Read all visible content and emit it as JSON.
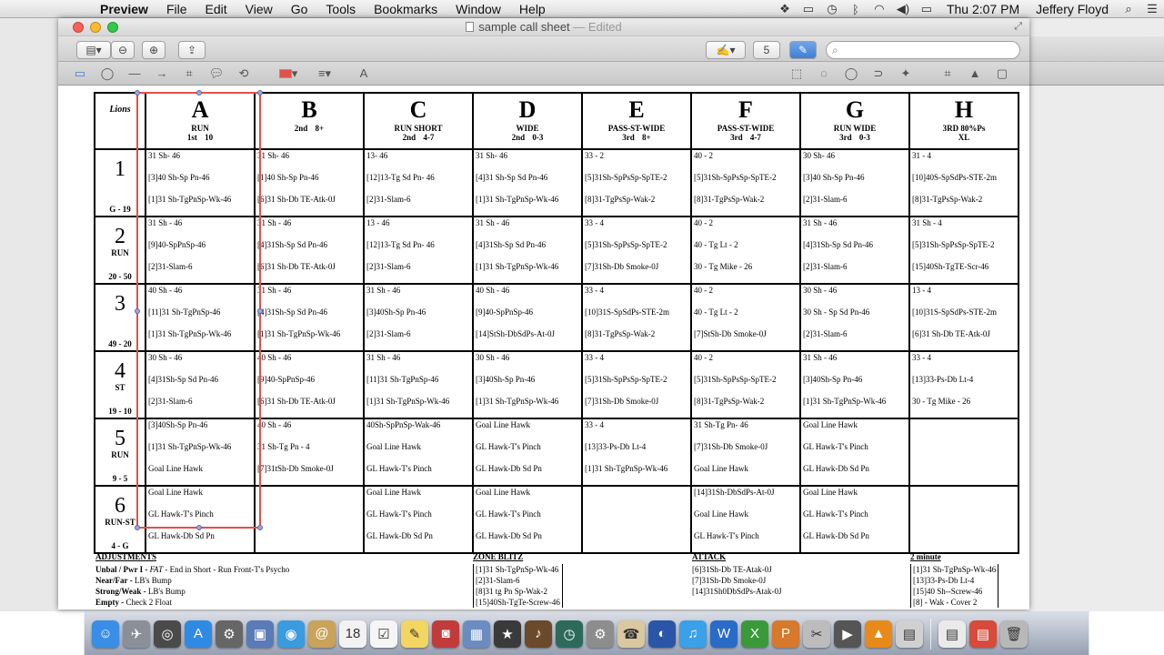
{
  "menubar": {
    "app": "Preview",
    "items": [
      "File",
      "Edit",
      "View",
      "Go",
      "Tools",
      "Bookmarks",
      "Window",
      "Help"
    ],
    "clock": "Thu 2:07 PM",
    "user": "Jeffery Floyd"
  },
  "window": {
    "title": "sample call sheet",
    "title_status": "— Edited",
    "toolbar_number": "5",
    "search_placeholder": ""
  },
  "grid": {
    "corner_label": "Lions",
    "columns": [
      {
        "letter": "A",
        "cat": "RUN",
        "sub": "1st 10"
      },
      {
        "letter": "B",
        "cat": "",
        "sub": "2nd 8+"
      },
      {
        "letter": "C",
        "cat": "RUN SHORT",
        "sub": "2nd 4-7"
      },
      {
        "letter": "D",
        "cat": "WIDE",
        "sub": "2nd 0-3"
      },
      {
        "letter": "E",
        "cat": "PASS-ST-WIDE",
        "sub": "3rd 8+"
      },
      {
        "letter": "F",
        "cat": "PASS-ST-WIDE",
        "sub": "3rd 4-7"
      },
      {
        "letter": "G",
        "cat": "RUN WIDE",
        "sub": "3rd 0-3"
      },
      {
        "letter": "H",
        "cat": "3RD 80%Ps",
        "sub": "XL"
      }
    ],
    "rows": [
      {
        "num": "1",
        "type": "",
        "range": "G - 19",
        "cells": [
          [
            "31 Sh- 46",
            "[3]40 Sh-Sp Pn-46",
            "[1]31 Sh-TgPnSp-Wk-46"
          ],
          [
            "31 Sh- 46",
            "[1]40 Sh-Sp Pn-46",
            "[6]31 Sh-Db TE-Atk-0J"
          ],
          [
            "13- 46",
            "[12]13-Tg Sd Pn- 46",
            "[2]31-Slam-6"
          ],
          [
            "31 Sh- 46",
            "[4]31 Sh-Sp Sd Pn-46",
            "[1]31 Sh-TgPnSp-Wk-46"
          ],
          [
            "33 - 2",
            "[5]31Sh-SpPsSp-SpTE-2",
            "[8]31-TgPsSp-Wak-2"
          ],
          [
            "40 - 2",
            "[5]31Sh-SpPsSp-SpTE-2",
            "[8]31-TgPsSp-Wak-2"
          ],
          [
            "30 Sh- 46",
            "[3]40 Sh-Sp Pn-46",
            "[2]31-Slam-6"
          ],
          [
            "31 - 4",
            "[10]40S-SpSdPs-STE-2m",
            "[8]31-TgPsSp-Wak-2"
          ]
        ]
      },
      {
        "num": "2",
        "type": "RUN",
        "range": "20 - 50",
        "cells": [
          [
            "31 Sh - 46",
            "[9]40-SpPnSp-46",
            "[2]31-Slam-6"
          ],
          [
            "31 Sh - 46",
            "[4]31Sh-Sp Sd Pn-46",
            "[6]31 Sh-Db TE-Atk-0J"
          ],
          [
            "13 - 46",
            "[12]13-Tg Sd Pn- 46",
            "[2]31-Slam-6"
          ],
          [
            "31 Sh - 46",
            "[4]31Sh-Sp Sd Pn-46",
            "[1]31 Sh-TgPnSp-Wk-46"
          ],
          [
            "33 - 4",
            "[5]31Sh-SpPsSp-SpTE-2",
            "[7]31Sh-Db Smoke-0J"
          ],
          [
            "40 - 2",
            "40 - Tg Lt - 2",
            "30 - Tg Mike - 26"
          ],
          [
            "31 Sh - 46",
            "[4]31Sh-Sp Sd Pn-46",
            "[2]31-Slam-6"
          ],
          [
            "31 Sh - 4",
            "[5]31Sh-SpPsSp-SpTE-2",
            "[15]40Sh-TgTE-Scr-46"
          ]
        ]
      },
      {
        "num": "3",
        "type": "",
        "range": "49 - 20",
        "cells": [
          [
            "40 Sh - 46",
            "[11]31 Sh-TgPnSp-46",
            "[1]31 Sh-TgPnSp-Wk-46"
          ],
          [
            "31 Sh - 46",
            "[4]31Sh-Sp Sd Pn-46",
            "[1]31 Sh-TgPnSp-Wk-46"
          ],
          [
            "31 Sh - 46",
            "[3]40Sh-Sp Pn-46",
            "[2]31-Slam-6"
          ],
          [
            "40 Sh - 46",
            "[9]40-SpPnSp-46",
            "[14]StSh-DbSdPs-At-0J"
          ],
          [
            "33 - 4",
            "[10]31S-SpSdPs-STE-2m",
            "[8]31-TgPsSp-Wak-2"
          ],
          [
            "40 - 2",
            "40 - Tg Lt - 2",
            "[7]StSh-Db Smoke-0J"
          ],
          [
            "30 Sh - 46",
            "30 Sh - Sp Sd Pn-46",
            "[2]31-Slam-6"
          ],
          [
            "13 - 4",
            "[10]31S-SpSdPs-STE-2m",
            "[6]31 Sh-Db TE-Atk-0J"
          ]
        ]
      },
      {
        "num": "4",
        "type": "ST",
        "range": "19 - 10",
        "cells": [
          [
            "30 Sh - 46",
            "[4]31Sh-Sp Sd Pn-46",
            "[2]31-Slam-6"
          ],
          [
            "40 Sh - 46",
            "[9]40-SpPnSp-46",
            "[6]31 Sh-Db TE-Atk-0J"
          ],
          [
            "31 Sh - 46",
            "[11]31 Sh-TgPnSp-46",
            "[1]31 Sh-TgPnSp-Wk-46"
          ],
          [
            "30 Sh - 46",
            "[3]40Sh-Sp Pn-46",
            "[1]31 Sh-TgPnSp-Wk-46"
          ],
          [
            "33 - 4",
            "[5]31Sh-SpPsSp-SpTE-2",
            "[7]31Sh-Db Smoke-0J"
          ],
          [
            "40 - 2",
            "[5]31Sh-SpPsSp-SpTE-2",
            "[8]31-TgPsSp-Wak-2"
          ],
          [
            "31 Sh - 46",
            "[3]40Sh-Sp Pn-46",
            "[1]31 Sh-TgPnSp-Wk-46"
          ],
          [
            "33 - 4",
            "[13]33-Ps-Db Lt-4",
            "30 - Tg Mike - 26"
          ]
        ]
      },
      {
        "num": "5",
        "type": "RUN",
        "range": "9 - 5",
        "cells": [
          [
            "[3]40Sh-Sp Pn-46",
            "[1]31 Sh-TgPnSp-Wk-46",
            "Goal Line Hawk"
          ],
          [
            "40 Sh - 46",
            "31 Sh-Tg Pn - 4",
            "[7]31tSh-Db Smoke-0J"
          ],
          [
            "40Sh-SpPnSp-Wak-46",
            "Goal Line Hawk",
            "GL Hawk-T's Pinch"
          ],
          [
            "Goal Line Hawk",
            "GL Hawk-T's Pinch",
            "GL Hawk-Db Sd Pn"
          ],
          [
            "33 - 4",
            "[13]33-Ps-Db Lt-4",
            "[1]31 Sh-TgPnSp-Wk-46"
          ],
          [
            "31 Sh-Tg Pn- 46",
            "[7]31Sh-Db Smoke-0J",
            "Goal Line Hawk"
          ],
          [
            "Goal Line Hawk",
            "GL Hawk-T's Pinch",
            "GL Hawk-Db Sd Pn"
          ],
          [
            "",
            "",
            ""
          ]
        ]
      },
      {
        "num": "6",
        "type": "RUN-ST",
        "range": "4 - G",
        "cells": [
          [
            "Goal Line Hawk",
            "GL Hawk-T's Pinch",
            "GL Hawk-Db Sd Pn"
          ],
          [
            "",
            "",
            ""
          ],
          [
            "Goal Line Hawk",
            "GL Hawk-T's Pinch",
            "GL Hawk-Db Sd Pn"
          ],
          [
            "Goal Line Hawk",
            "GL Hawk-T's Pinch",
            "GL Hawk-Db Sd Pn"
          ],
          [
            "",
            "",
            ""
          ],
          [
            "[14]31Sh-DbSdPs-At-0J",
            "Goal Line Hawk",
            "GL Hawk-T's Pinch"
          ],
          [
            "Goal Line Hawk",
            "GL Hawk-T's Pinch",
            "GL Hawk-Db Sd Pn"
          ],
          [
            "",
            "",
            ""
          ]
        ]
      }
    ]
  },
  "adjustments": {
    "header": "ADJUSTMENTS",
    "rows": [
      {
        "bold": "Unbal / Pwr I - ",
        "italic": "FAT",
        "rest": " - End in Short - Run Front-T's Psycho"
      },
      {
        "bold": "Near/Far - ",
        "italic": "",
        "rest": "LB's Bump"
      },
      {
        "bold": "Strong/Weak - ",
        "italic": "",
        "rest": "LB's Bump"
      },
      {
        "bold": "Empty - ",
        "italic": "",
        "rest": "Check 2 Float"
      }
    ]
  },
  "zone_blitz": {
    "header": "ZONE BLITZ",
    "rows": [
      "[1]31 Sh-TgPnSp-Wk-46",
      "[2]31-Slam-6",
      "[8]31 tg Pn Sp-Wak-2",
      "[15]40Sh-TgTe-Screw-46"
    ]
  },
  "attack": {
    "header": "ATTACK",
    "rows": [
      "[6]31Sh-Db TE-Atak-0J",
      "[7]31Sh-Db Smoke-0J",
      "[14]31Sh0DbSdPs-Atak-0J"
    ]
  },
  "two_minute": {
    "header": "2 minute",
    "rows": [
      "[1]31 Sh-TgPnSp-Wk-46",
      "[13]33-Ps-Db Lt-4",
      "[15]40 Sh--Screw-46",
      "[8] - Wak - Cover 2"
    ]
  },
  "dock": {
    "apps": [
      {
        "name": "finder-icon",
        "color": "#3a8ee6",
        "glyph": "☺"
      },
      {
        "name": "launchpad-icon",
        "color": "#8a8f9a",
        "glyph": "✈"
      },
      {
        "name": "dashboard-icon",
        "color": "#4a4a4a",
        "glyph": "◎"
      },
      {
        "name": "app-store-icon",
        "color": "#2f8ae4",
        "glyph": "A"
      },
      {
        "name": "system-clock-icon",
        "color": "#666",
        "glyph": "⚙"
      },
      {
        "name": "photo-app-icon",
        "color": "#5a7bb7",
        "glyph": "▣"
      },
      {
        "name": "safari-icon",
        "color": "#3b9be0",
        "glyph": "◉"
      },
      {
        "name": "mail-icon",
        "color": "#c9a35a",
        "glyph": "@"
      },
      {
        "name": "calendar-icon",
        "color": "#f2f2f2",
        "glyph": "18"
      },
      {
        "name": "reminders-icon",
        "color": "#f5f5f5",
        "glyph": "☑"
      },
      {
        "name": "notes-icon",
        "color": "#f3d561",
        "glyph": "✎"
      },
      {
        "name": "photo-booth-icon",
        "color": "#c23b3b",
        "glyph": "◙"
      },
      {
        "name": "preview-icon",
        "color": "#6a8cc2",
        "glyph": "▦"
      },
      {
        "name": "imovie-icon",
        "color": "#3a3a3a",
        "glyph": "★"
      },
      {
        "name": "garageband-icon",
        "color": "#6a4a2a",
        "glyph": "♪"
      },
      {
        "name": "time-machine-icon",
        "color": "#2e6a5a",
        "glyph": "◷"
      },
      {
        "name": "system-preferences-icon",
        "color": "#8d8d8d",
        "glyph": "⚙"
      },
      {
        "name": "contacts-icon",
        "color": "#d9c8a0",
        "glyph": "☎"
      },
      {
        "name": "dvd-player-icon",
        "color": "#2a55a8",
        "glyph": "◐"
      },
      {
        "name": "itunes-icon",
        "color": "#3aa0e8",
        "glyph": "♫"
      },
      {
        "name": "word-icon",
        "color": "#2a6bc8",
        "glyph": "W"
      },
      {
        "name": "excel-icon",
        "color": "#3a9a3a",
        "glyph": "X"
      },
      {
        "name": "powerpoint-icon",
        "color": "#d8782a",
        "glyph": "P"
      },
      {
        "name": "photo-editor-icon",
        "color": "#bcbcbc",
        "glyph": "✂"
      },
      {
        "name": "facetime-icon",
        "color": "#555",
        "glyph": "▶"
      },
      {
        "name": "vlc-icon",
        "color": "#e88a1a",
        "glyph": "▲"
      },
      {
        "name": "files-icon",
        "color": "#d0d0d0",
        "glyph": "▤"
      }
    ],
    "right_items": [
      {
        "name": "document-icon",
        "color": "#eaeaea",
        "glyph": "▤"
      },
      {
        "name": "pdf-icon",
        "color": "#d84a3a",
        "glyph": "▤"
      },
      {
        "name": "trash-icon",
        "color": "#b8b8b8",
        "glyph": "🗑"
      }
    ]
  }
}
